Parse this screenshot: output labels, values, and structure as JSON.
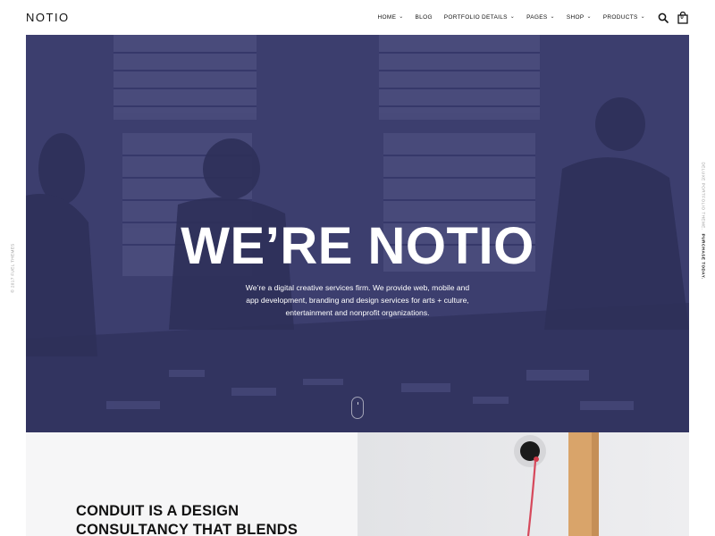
{
  "header": {
    "logo": "NOTIO",
    "nav": [
      {
        "label": "HOME",
        "dropdown": true
      },
      {
        "label": "BLOG",
        "dropdown": false
      },
      {
        "label": "PORTFOLIO DETAILS",
        "dropdown": true
      },
      {
        "label": "PAGES",
        "dropdown": true
      },
      {
        "label": "SHOP",
        "dropdown": true
      },
      {
        "label": "PRODUCTS",
        "dropdown": true
      }
    ],
    "search_icon": "search-icon",
    "cart_icon": "shopping-bag-icon",
    "cart_count": "0"
  },
  "hero": {
    "title": "WE’RE NOTIO",
    "subtitle": "We’re a digital creative services firm. We provide web, mobile and app development, branding and design services for arts + culture, entertainment and nonprofit organizations.",
    "overlay_color": "#3b3d6d",
    "scroll_icon": "mouse-scroll-icon"
  },
  "side": {
    "left": "© 2017 FUEL THEMES",
    "right_text": "DELUXE PORTFOLIO THEME.",
    "right_link": "PURCHASE TODAY."
  },
  "section": {
    "heading": "CONDUIT IS A DESIGN CONSULTANCY THAT BLENDS"
  }
}
